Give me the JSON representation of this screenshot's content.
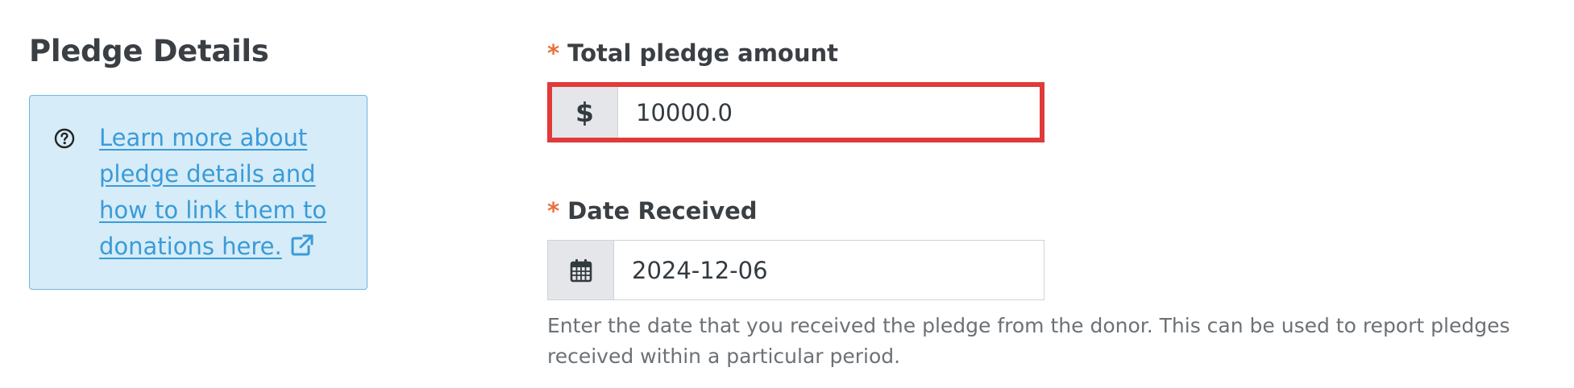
{
  "sidebar": {
    "title": "Pledge Details",
    "info_link": "Learn more about pledge details and how to link them to donations here."
  },
  "fields": {
    "required_marker": "*",
    "amount": {
      "label": "Total pledge amount",
      "prefix": "$",
      "value": "10000.0"
    },
    "date_received": {
      "label": "Date Received",
      "value": "2024-12-06",
      "help": "Enter the date that you received the pledge from the donor. This can be used to report pledges received within a particular period."
    }
  },
  "icons": {
    "info": "question-circle-icon",
    "external": "external-link-icon",
    "calendar": "calendar-icon"
  },
  "colors": {
    "highlight_border": "#e03a3a",
    "required_star": "#e9703a",
    "link": "#3a9bd8",
    "info_bg": "#d6ecf8"
  }
}
